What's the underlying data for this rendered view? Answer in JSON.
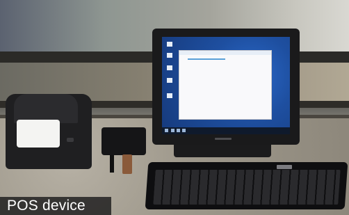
{
  "image": {
    "caption": "POS device"
  },
  "colors": {
    "caption_text": "#ffffff",
    "caption_background": "#141416",
    "screen_blue": "#1e4fa0"
  },
  "icons": {
    "printer": "receipt-printer-icon",
    "monitor": "monitor-icon",
    "keyboard": "keyboard-icon",
    "power": "power-adapter-icon"
  }
}
